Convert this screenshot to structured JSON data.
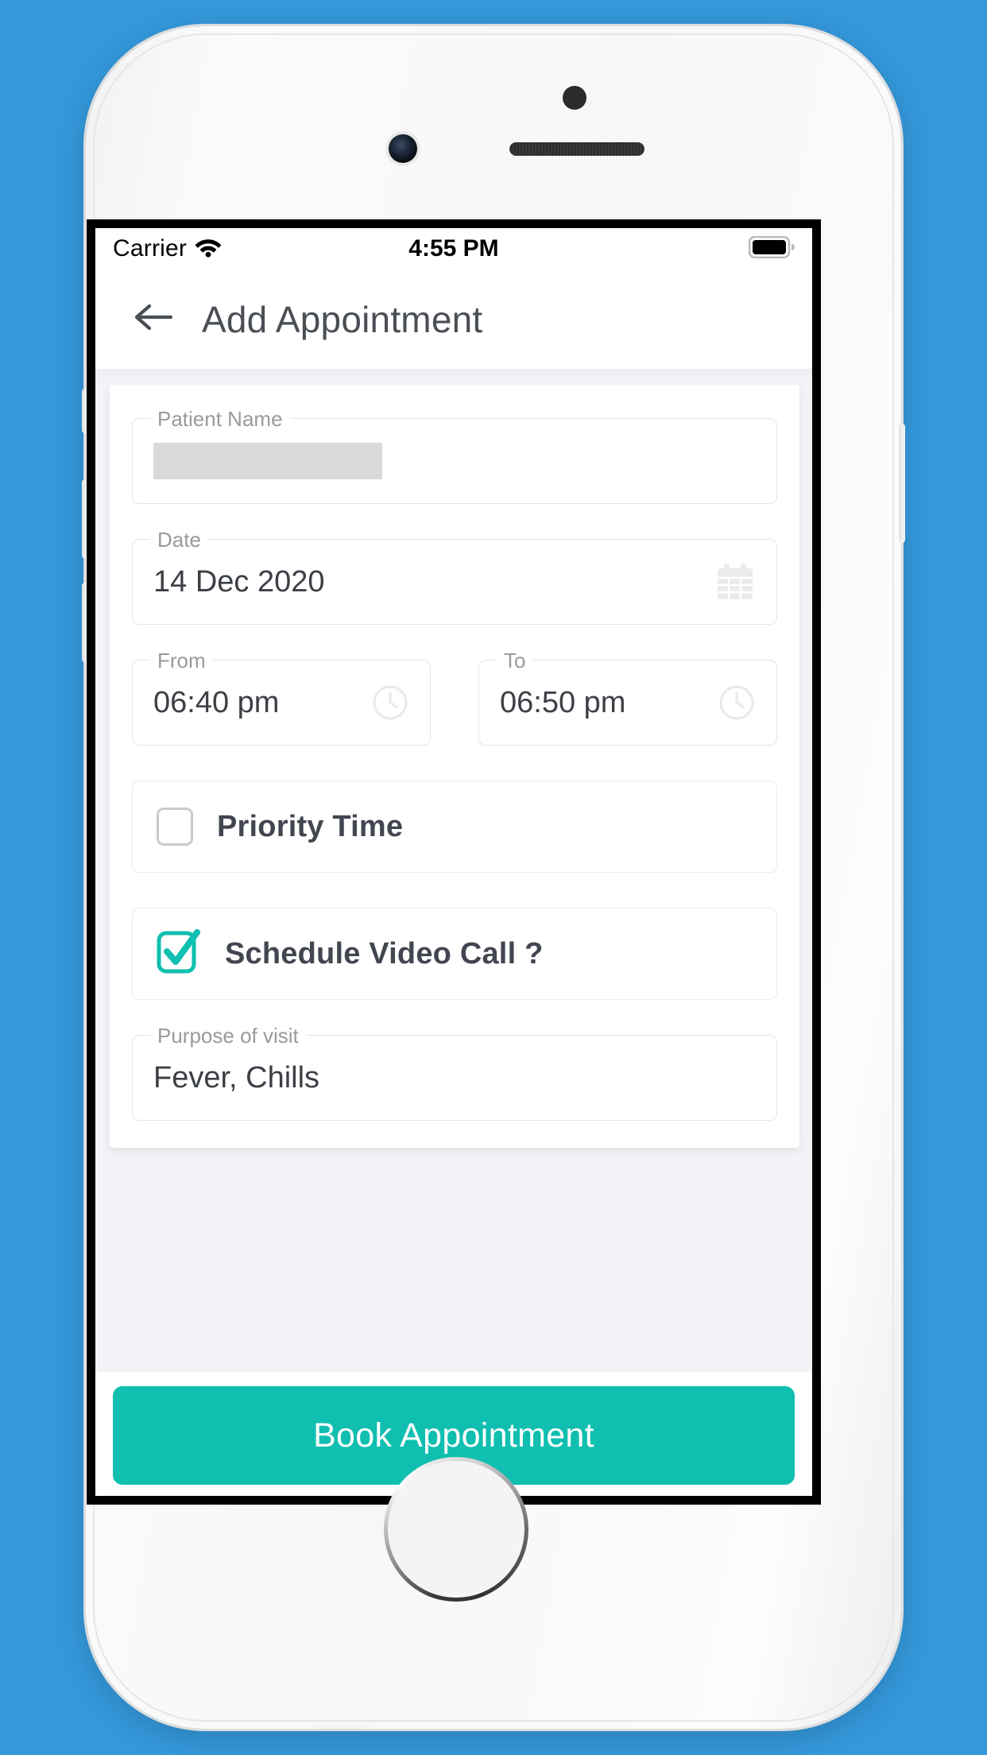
{
  "theme": {
    "page_background": "#3498db",
    "accent": "#10bfb0",
    "screen_background": "#f1f3f7",
    "card_background": "#ffffff",
    "label_color": "#9a9a9e",
    "value_color": "#3c4046"
  },
  "status_bar": {
    "carrier": "Carrier",
    "wifi_icon": "wifi-icon",
    "time": "4:55 PM",
    "battery_icon": "battery-full-icon"
  },
  "app_bar": {
    "back_icon": "arrow-left-icon",
    "title": "Add Appointment"
  },
  "form": {
    "patient_name": {
      "label": "Patient Name",
      "value": "",
      "redacted": true
    },
    "date": {
      "label": "Date",
      "value": "14 Dec 2020",
      "icon": "calendar-icon"
    },
    "from_time": {
      "label": "From",
      "value": "06:40 pm",
      "icon": "clock-icon"
    },
    "to_time": {
      "label": "To",
      "value": "06:50 pm",
      "icon": "clock-icon"
    },
    "priority_time": {
      "label": "Priority Time",
      "checked": false,
      "icon": "checkbox-unchecked-icon"
    },
    "schedule_video_call": {
      "label": "Schedule Video Call ?",
      "checked": true,
      "icon": "checkbox-checked-icon"
    },
    "purpose_of_visit": {
      "label": "Purpose of visit",
      "value": "Fever, Chills"
    }
  },
  "footer": {
    "submit_label": "Book Appointment"
  },
  "device": {
    "home_button": "home-button",
    "front_camera": "front-camera",
    "earpiece": "earpiece-speaker",
    "proximity_sensor": "proximity-sensor"
  }
}
